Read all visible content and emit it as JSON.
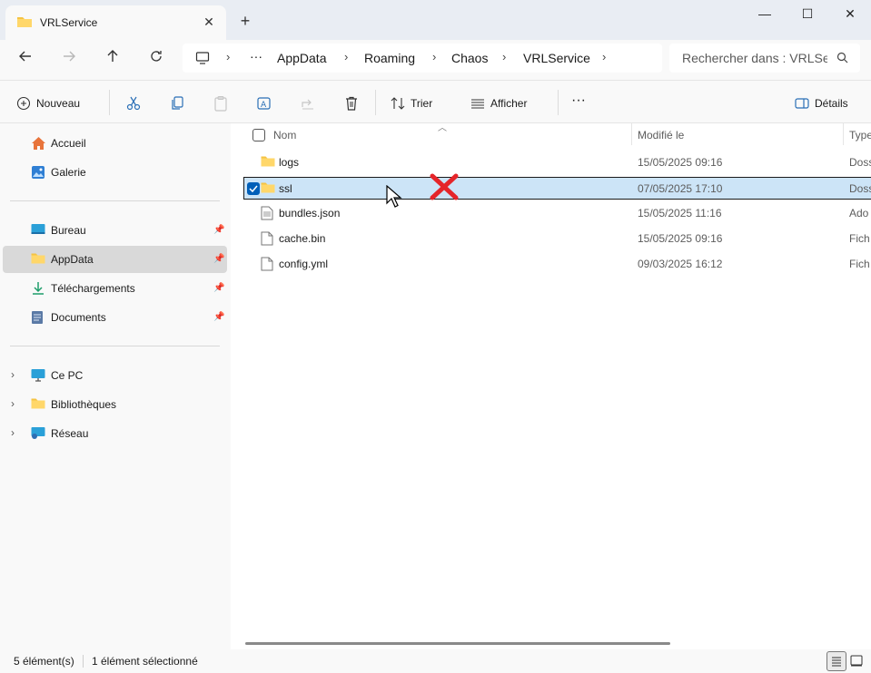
{
  "window": {
    "tab_title": "VRLService",
    "tab_close": "✕",
    "new_tab": "+",
    "minimize": "—",
    "maximize": "☐",
    "close": "✕"
  },
  "address": {
    "breadcrumbs": [
      "AppData",
      "Roaming",
      "Chaos",
      "VRLService"
    ],
    "overflow": "···",
    "search_placeholder": "Rechercher dans : VRLSe"
  },
  "toolbar": {
    "new_label": "Nouveau",
    "sort_label": "Trier",
    "view_label": "Afficher",
    "more_label": "···",
    "details_label": "Détails"
  },
  "sidebar": {
    "quick": [
      {
        "label": "Accueil",
        "icon": "home-icon"
      },
      {
        "label": "Galerie",
        "icon": "gallery-icon"
      }
    ],
    "pinned": [
      {
        "label": "Bureau",
        "icon": "desktop-icon"
      },
      {
        "label": "AppData",
        "icon": "folder-icon"
      },
      {
        "label": "Téléchargements",
        "icon": "download-icon"
      },
      {
        "label": "Documents",
        "icon": "documents-icon"
      }
    ],
    "tree": [
      {
        "label": "Ce PC",
        "icon": "pc-icon"
      },
      {
        "label": "Bibliothèques",
        "icon": "library-icon"
      },
      {
        "label": "Réseau",
        "icon": "network-icon"
      }
    ],
    "selected": "AppData"
  },
  "content": {
    "columns": {
      "name": "Nom",
      "modified": "Modifié le",
      "type": "Type"
    },
    "files": [
      {
        "name": "logs",
        "modified": "15/05/2025 09:16",
        "type": "Doss",
        "kind": "folder"
      },
      {
        "name": "ssl",
        "modified": "07/05/2025 17:10",
        "type": "Doss",
        "kind": "folder",
        "selected": true
      },
      {
        "name": "bundles.json",
        "modified": "15/05/2025 11:16",
        "type": "Ado",
        "kind": "json"
      },
      {
        "name": "cache.bin",
        "modified": "15/05/2025 09:16",
        "type": "Fich",
        "kind": "file"
      },
      {
        "name": "config.yml",
        "modified": "09/03/2025 16:12",
        "type": "Fich",
        "kind": "file"
      }
    ]
  },
  "status": {
    "count": "5 élément(s)",
    "selection": "1 élément sélectionné"
  },
  "colors": {
    "accent": "#005fb8",
    "selection": "#cce4f7",
    "folder": "#f5c343",
    "x_mark": "#e5252a"
  }
}
